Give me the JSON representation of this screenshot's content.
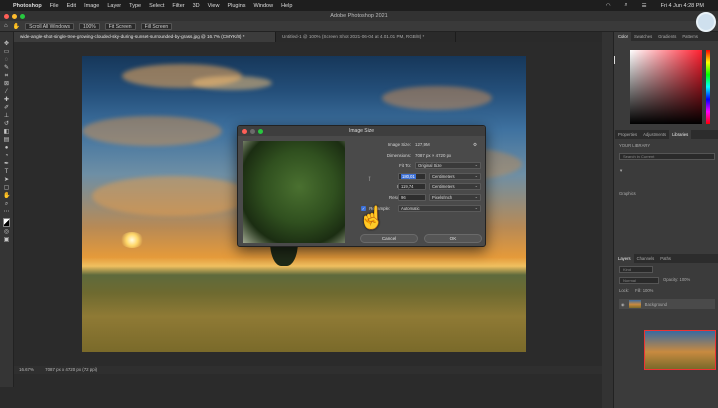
{
  "menubar": {
    "app": "Photoshop",
    "items": [
      "File",
      "Edit",
      "Image",
      "Layer",
      "Type",
      "Select",
      "Filter",
      "3D",
      "View",
      "Plugins",
      "Window",
      "Help"
    ],
    "datetime": "Fri 4 Jun  4:28 PM"
  },
  "titlebar": {
    "title": "Adobe Photoshop 2021"
  },
  "options": {
    "scroll_all": "Scroll All Windows",
    "zoom": "100%",
    "fit": "Fit Screen",
    "fill": "Fill Screen"
  },
  "tabs": [
    {
      "label": "wide-angle-shot-single-tree-growing-clouded-sky-during-sunset-surrounded-by-grass.jpg @ 16.7% (CMYK/8) *",
      "active": true
    },
    {
      "label": "Untitled-1 @ 100% (Screen Shot 2021-06-04 at 4.01.01 PM, RGB/8) *",
      "active": false
    }
  ],
  "status": {
    "zoom": "16.67%",
    "info": "7087 px x 4720 px (72 ppi)"
  },
  "panels": {
    "color_tabs": [
      "Color",
      "Swatches",
      "Gradients",
      "Patterns"
    ],
    "lib_tabs": [
      "Properties",
      "Adjustments",
      "Libraries"
    ],
    "library_name": "YOUR LIBRARY",
    "search_placeholder": "Search in Current",
    "graphics": "Graphics",
    "layer_tabs": [
      "Layers",
      "Channels",
      "Paths"
    ],
    "kind": "Kind",
    "blend": "Normal",
    "opacity": "Opacity: 100%",
    "lock": "Lock:",
    "fill": "Fill: 100%",
    "layer_name": "Background"
  },
  "dialog": {
    "title": "Image Size",
    "image_size_label": "Image Size:",
    "image_size_value": "127,9M",
    "dimensions_label": "Dimensions:",
    "dimensions_value": "7087 px  ×  4720 px",
    "fit_to_label": "Fit To:",
    "fit_to_value": "Original Size",
    "width_label": "Width:",
    "width_value": "180,01",
    "width_unit": "Centimeters",
    "height_label": "Height:",
    "height_value": "119,74",
    "height_unit": "Centimeters",
    "resolution_label": "Resolution:",
    "resolution_value": "96",
    "resolution_unit": "Pixels/Inch",
    "resample_label": "Resample:",
    "resample_value": "Automatic",
    "cancel": "Cancel",
    "ok": "OK"
  }
}
